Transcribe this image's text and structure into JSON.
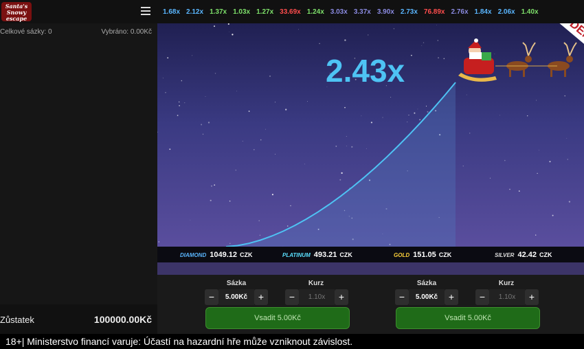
{
  "logo": {
    "text": "Santa's Snowy escape"
  },
  "left": {
    "total_bets_label": "Celkové sázky: 0",
    "collected_label": "Vybráno: 0.00Kč",
    "balance_label": "Zůstatek",
    "balance_value": "100000.00Kč"
  },
  "history": [
    {
      "v": "1.68x",
      "c": "#5ab6ff"
    },
    {
      "v": "2.12x",
      "c": "#5ab6ff"
    },
    {
      "v": "1.37x",
      "c": "#7ee06a"
    },
    {
      "v": "1.03x",
      "c": "#7ee06a"
    },
    {
      "v": "1.27x",
      "c": "#7ee06a"
    },
    {
      "v": "33.69x",
      "c": "#ff4d4d"
    },
    {
      "v": "1.24x",
      "c": "#7ee06a"
    },
    {
      "v": "3.03x",
      "c": "#8a8ae0"
    },
    {
      "v": "3.37x",
      "c": "#8a8ae0"
    },
    {
      "v": "3.90x",
      "c": "#8a8ae0"
    },
    {
      "v": "2.73x",
      "c": "#5ab6ff"
    },
    {
      "v": "76.89x",
      "c": "#ff4d4d"
    },
    {
      "v": "2.76x",
      "c": "#8a8ae0"
    },
    {
      "v": "1.84x",
      "c": "#5ab6ff"
    },
    {
      "v": "2.06x",
      "c": "#5ab6ff"
    },
    {
      "v": "1.40x",
      "c": "#7ee06a"
    }
  ],
  "game": {
    "multiplier": "2.43x",
    "demo": "DEMO",
    "curve_color": "#4ec3f4"
  },
  "jackpots": [
    {
      "name": "DIAMOND",
      "value": "1049.12",
      "currency": "CZK",
      "color": "#5ab6ff"
    },
    {
      "name": "PLATINUM",
      "value": "493.21",
      "currency": "CZK",
      "color": "#5ae0ff"
    },
    {
      "name": "GOLD",
      "value": "151.05",
      "currency": "CZK",
      "color": "#ffd23a"
    },
    {
      "name": "SILVER",
      "value": "42.42",
      "currency": "CZK",
      "color": "#dddddd"
    }
  ],
  "bet_panels": [
    {
      "stake_label": "Sázka",
      "stake_value": "5.00Kč",
      "odds_label": "Kurz",
      "odds_value": "1.10x",
      "minus": "−",
      "plus": "+",
      "button": "Vsadit 5.00Kč"
    },
    {
      "stake_label": "Sázka",
      "stake_value": "5.00Kč",
      "odds_label": "Kurz",
      "odds_value": "1.10x",
      "minus": "−",
      "plus": "+",
      "button": "Vsadit 5.00Kč"
    }
  ],
  "footer": "18+| Ministerstvo financí varuje: Účastí na hazardní hře může vzniknout závislost."
}
